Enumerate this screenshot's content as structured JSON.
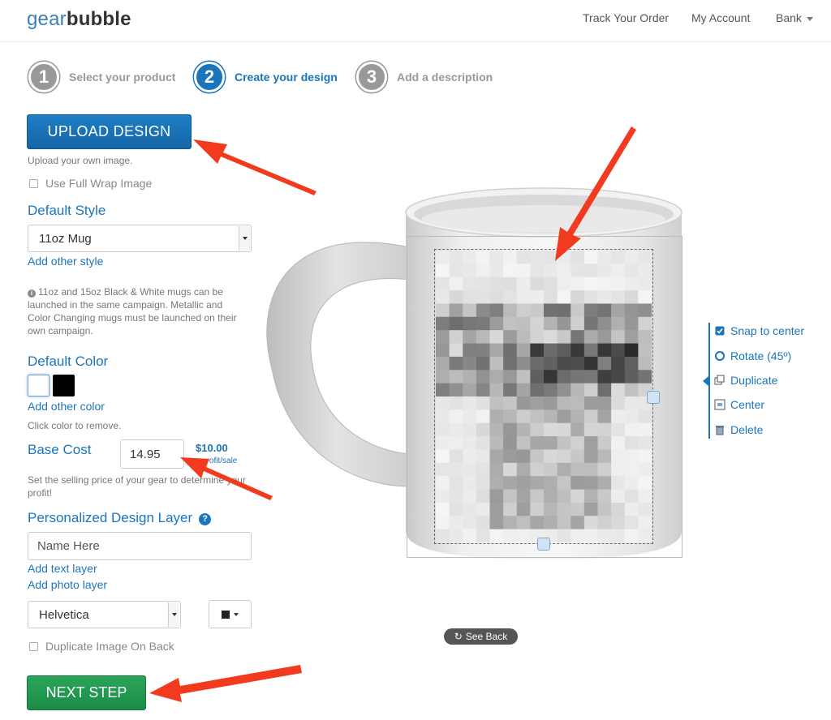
{
  "header": {
    "logo_part1": "gear",
    "logo_part2": "bubble",
    "track_order": "Track Your Order",
    "my_account": "My Account",
    "user_name": "Bank"
  },
  "steps": [
    {
      "number": "1",
      "label": "Select your product",
      "active": false
    },
    {
      "number": "2",
      "label": "Create your design",
      "active": true
    },
    {
      "number": "3",
      "label": "Add a description",
      "active": false
    }
  ],
  "upload": {
    "button_label": "UPLOAD DESIGN",
    "help_text": "Upload your own image.",
    "full_wrap_label": "Use Full Wrap Image"
  },
  "style": {
    "title": "Default Style",
    "selected": "11oz Mug",
    "add_link": "Add other style",
    "info_text": "11oz and 15oz Black & White mugs can be launched in the same campaign. Metallic and Color Changing mugs must be launched on their own campaign."
  },
  "color": {
    "title": "Default Color",
    "swatches": [
      "#ffffff",
      "#000000"
    ],
    "add_link": "Add other color",
    "help_text": "Click color to remove."
  },
  "cost": {
    "title": "Base Cost",
    "value": "14.95",
    "profit": "$10.00",
    "profit_label": "profit/sale",
    "help_text": "Set the selling price of your gear to determine your profit!"
  },
  "personalized": {
    "title": "Personalized Design Layer",
    "help_icon": "?",
    "placeholder": "Name Here",
    "add_text_link": "Add text layer",
    "add_photo_link": "Add photo layer",
    "font_selected": "Helvetica",
    "text_color": "#222222"
  },
  "duplicate_back_label": "Duplicate Image On Back",
  "next_button_label": "NEXT STEP",
  "tools": {
    "snap": "Snap to center",
    "rotate": "Rotate (45º)",
    "duplicate": "Duplicate",
    "center": "Center",
    "delete": "Delete"
  },
  "see_back_label": "See Back",
  "colors": {
    "brand_blue": "#1b75bb",
    "upload_btn": "#1e7fc6",
    "next_btn": "#2aa55a",
    "arrow_red": "#f23a1e"
  }
}
